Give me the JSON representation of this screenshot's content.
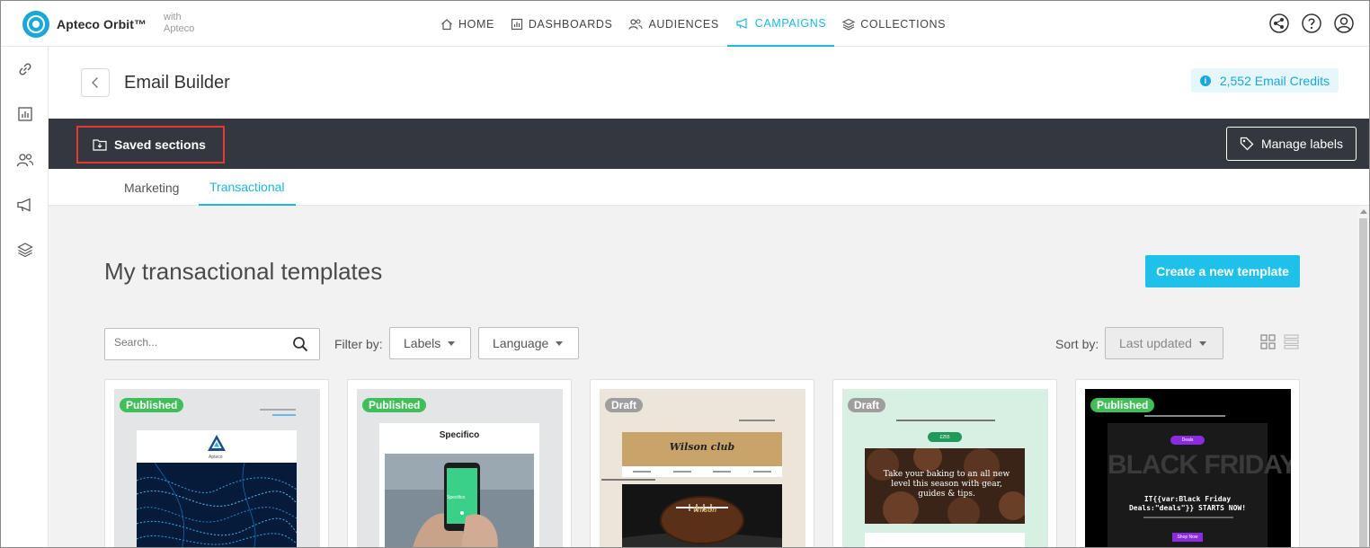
{
  "app": {
    "name": "Apteco Orbit™",
    "with_line1": "with",
    "with_line2": "Apteco"
  },
  "nav": [
    {
      "label": "HOME",
      "icon": "home-icon"
    },
    {
      "label": "DASHBOARDS",
      "icon": "dashboard-icon"
    },
    {
      "label": "AUDIENCES",
      "icon": "audiences-icon"
    },
    {
      "label": "CAMPAIGNS",
      "icon": "campaigns-icon",
      "active": true
    },
    {
      "label": "COLLECTIONS",
      "icon": "collections-icon"
    }
  ],
  "rail_icons": [
    "link-icon",
    "chart-icon",
    "people-icon",
    "megaphone-icon",
    "layers-icon"
  ],
  "header": {
    "title": "Email Builder",
    "credits": "2,552 Email Credits"
  },
  "toolbar": {
    "saved_sections": "Saved sections",
    "manage_labels": "Manage labels"
  },
  "tabs": [
    {
      "label": "Marketing"
    },
    {
      "label": "Transactional",
      "active": true
    }
  ],
  "main": {
    "title": "My transactional templates",
    "create_button": "Create a new template",
    "search_placeholder": "Search...",
    "filter_label": "Filter by:",
    "filter_labels": "Labels",
    "filter_language": "Language",
    "sort_label": "Sort by:",
    "sort_value": "Last updated"
  },
  "cards": [
    {
      "status": "Published",
      "brand": "Apteco"
    },
    {
      "status": "Published",
      "brand": "Specifico",
      "phone_text": "Specifico"
    },
    {
      "status": "Draft",
      "brand": "Wilson club",
      "ball_text": "Wilson"
    },
    {
      "status": "Draft",
      "cta": "£255",
      "headline": "Take your baking to an all new level this season with gear, guides & tips."
    },
    {
      "status": "Published",
      "pill": "Deals",
      "big": "BLACK FRIDAY",
      "headline": "IT{{var:Black Friday Deals:\"deals\"}} STARTS NOW!",
      "cta": "Shop Now"
    }
  ],
  "colors": {
    "accent": "#1fb6e0",
    "dark_toolbar": "#34373d",
    "published": "#3fbf58",
    "draft": "#9e9e9e",
    "highlight_border": "#e53935"
  }
}
